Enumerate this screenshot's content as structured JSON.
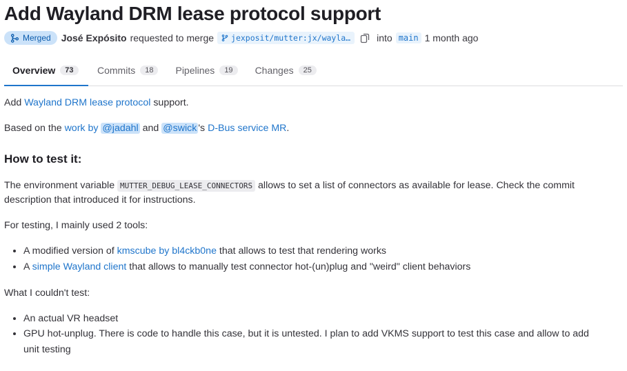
{
  "title": "Add Wayland DRM lease protocol support",
  "meta": {
    "badge": "Merged",
    "author": "José Expósito",
    "action": "requested to merge",
    "source_branch": "jexposit/mutter:jx/wayla…",
    "into": "into",
    "target_branch": "main",
    "time": "1 month ago"
  },
  "tabs": [
    {
      "label": "Overview",
      "count": "73"
    },
    {
      "label": "Commits",
      "count": "18"
    },
    {
      "label": "Pipelines",
      "count": "19"
    },
    {
      "label": "Changes",
      "count": "25"
    }
  ],
  "body": {
    "p1": {
      "pre": "Add ",
      "link": "Wayland DRM lease protocol",
      "post": " support."
    },
    "p2": {
      "pre": "Based on the ",
      "link1": "work by ",
      "mention1": "@jadahl",
      "and": " and ",
      "mention2": "@swick",
      "apos": "'s ",
      "link2": "D-Bus service MR",
      "end": "."
    },
    "heading": "How to test it:",
    "p3": {
      "pre": "The environment variable ",
      "code": "MUTTER_DEBUG_LEASE_CONNECTORS",
      "post": " allows to set a list of connectors as available for lease. Check the commit",
      "line2": "description that introduced it for instructions."
    },
    "p4": "For testing, I mainly used 2 tools:",
    "tools": [
      {
        "pre": "A modified version of ",
        "link": "kmscube by bl4ckb0ne",
        "post": " that allows to test that rendering works"
      },
      {
        "pre": "A ",
        "link": "simple Wayland client",
        "post": " that allows to manually test connector hot-(un)plug and \"weird\" client behaviors"
      }
    ],
    "p5": "What I couldn't test:",
    "untested": [
      "An actual VR headset",
      "GPU hot-unplug. There is code to handle this case, but it is untested. I plan to add VKMS support to test this case and allow to add",
      "unit testing"
    ]
  }
}
